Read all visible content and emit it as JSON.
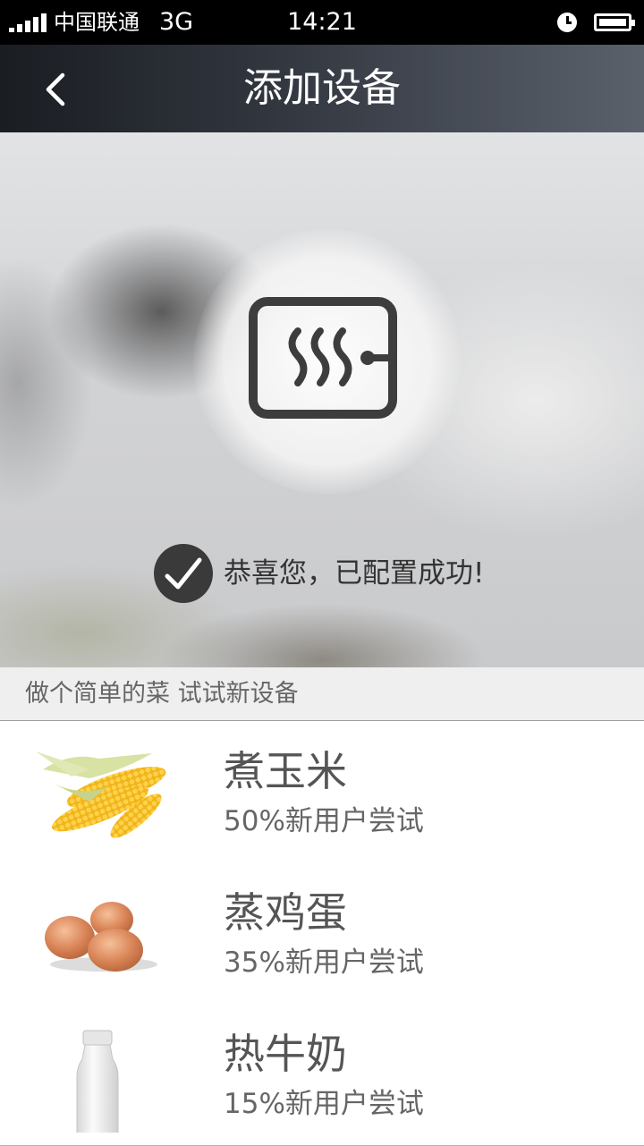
{
  "status_bar": {
    "carrier": "中国联通",
    "network": "3G",
    "time": "14:21",
    "icons": [
      "signal-icon",
      "alarm-icon",
      "battery-icon"
    ]
  },
  "nav": {
    "title": "添加设备",
    "back_icon": "chevron-left-icon"
  },
  "hero": {
    "device_icon": "steamer-device-icon",
    "success_icon": "check-circle-icon",
    "success_text": "恭喜您，已配置成功!"
  },
  "recipes": {
    "header": "做个简单的菜 试试新设备",
    "items": [
      {
        "name": "煮玉米",
        "stat": "50%新用户尝试",
        "image": "corn"
      },
      {
        "name": "蒸鸡蛋",
        "stat": "35%新用户尝试",
        "image": "eggs"
      },
      {
        "name": "热牛奶",
        "stat": "15%新用户尝试",
        "image": "milk-bottle"
      }
    ]
  },
  "colors": {
    "nav_gradient_start": "#1a1d22",
    "nav_gradient_end": "#5b616b",
    "icon_dark": "#3a3a3a",
    "text_gray": "#666666"
  }
}
